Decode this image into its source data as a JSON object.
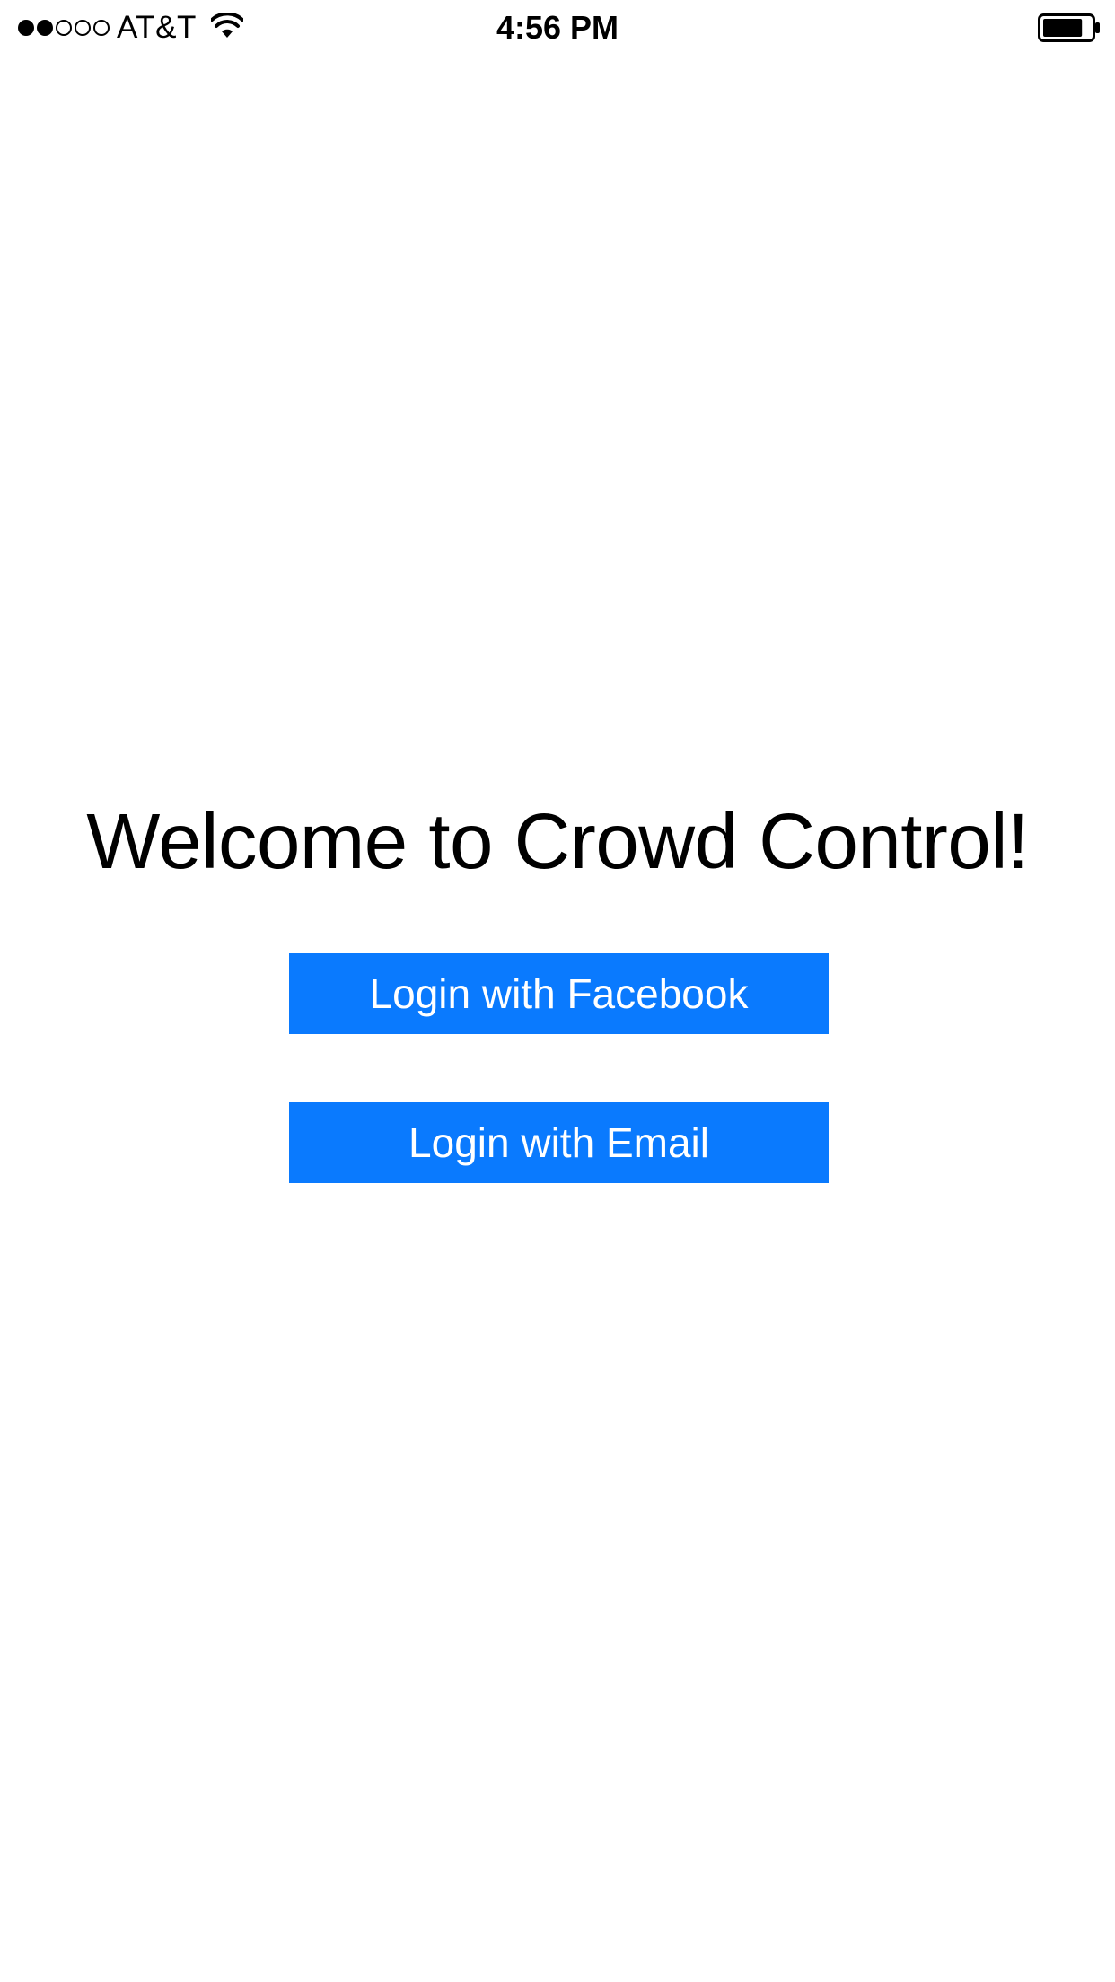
{
  "status_bar": {
    "signal_bars_total": 5,
    "signal_bars_filled": 2,
    "signal_icon": "signal-strength-dots",
    "carrier": "AT&T",
    "wifi_icon": "wifi-icon",
    "time": "4:56 PM",
    "battery_icon": "battery-icon",
    "battery_level": 0.8
  },
  "welcome": {
    "title": "Welcome to Crowd Control!"
  },
  "buttons": {
    "facebook_label": "Login with Facebook",
    "email_label": "Login with Email"
  },
  "colors": {
    "button_background": "#0a7afe",
    "button_text": "#ffffff",
    "page_background": "#ffffff"
  }
}
